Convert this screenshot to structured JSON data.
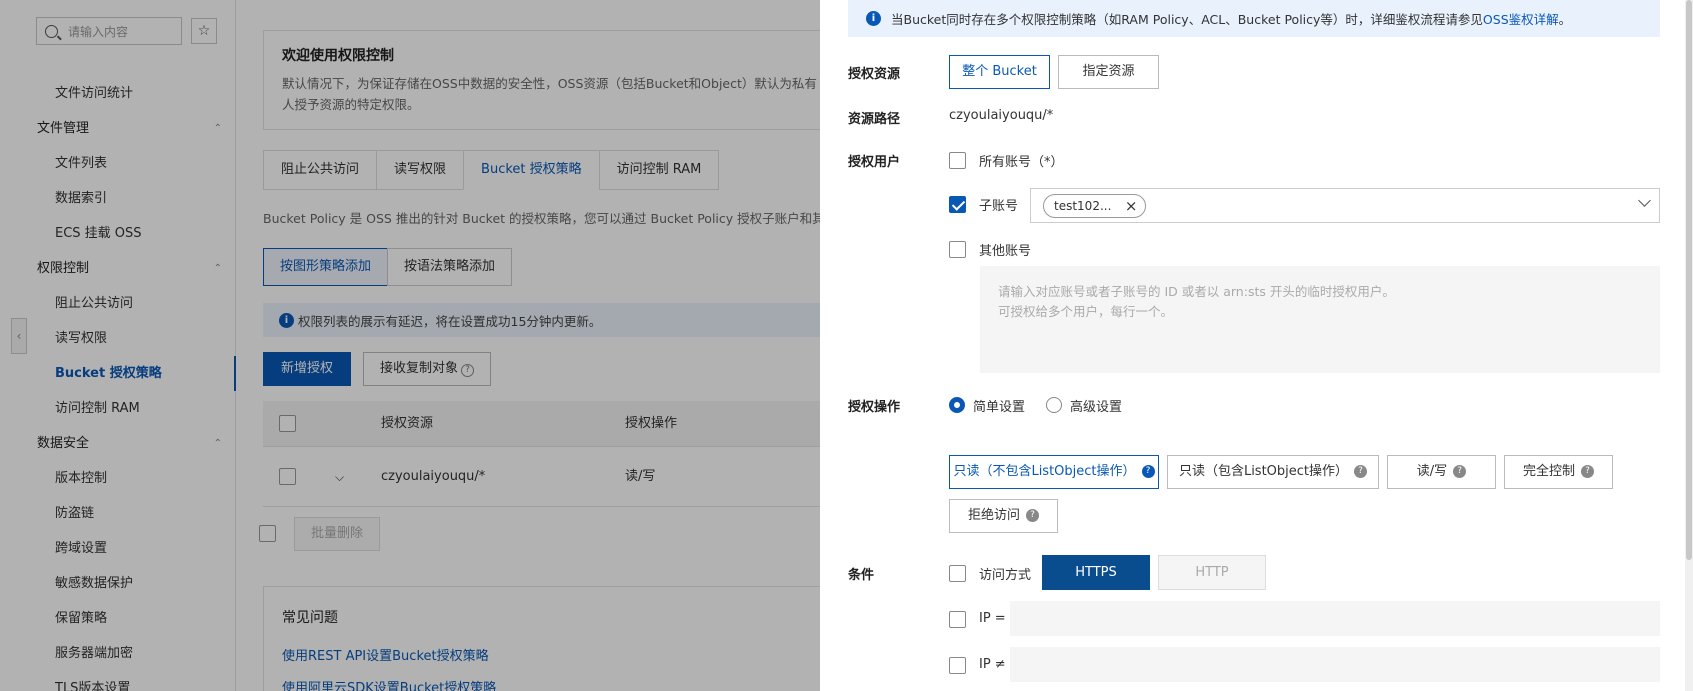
{
  "sidebar": {
    "search_placeholder": "请输入内容",
    "star": "☆",
    "items": [
      {
        "type": "item",
        "label": "文件访问统计"
      },
      {
        "type": "group",
        "label": "文件管理"
      },
      {
        "type": "item",
        "label": "文件列表"
      },
      {
        "type": "item",
        "label": "数据索引"
      },
      {
        "type": "item",
        "label": "ECS 挂载 OSS"
      },
      {
        "type": "group",
        "label": "权限控制"
      },
      {
        "type": "item",
        "label": "阻止公共访问"
      },
      {
        "type": "item",
        "label": "读写权限"
      },
      {
        "type": "item",
        "label": "Bucket 授权策略",
        "active": true
      },
      {
        "type": "item",
        "label": "访问控制 RAM"
      },
      {
        "type": "group",
        "label": "数据安全"
      },
      {
        "type": "item",
        "label": "版本控制"
      },
      {
        "type": "item",
        "label": "防盗链"
      },
      {
        "type": "item",
        "label": "跨域设置"
      },
      {
        "type": "item",
        "label": "敏感数据保护"
      },
      {
        "type": "item",
        "label": "保留策略"
      },
      {
        "type": "item",
        "label": "服务器端加密"
      },
      {
        "type": "item",
        "label": "TLS版本设置"
      }
    ]
  },
  "main": {
    "welcome_title": "欢迎使用权限控制",
    "welcome_text": "默认情况下，为保证存储在OSS中数据的安全性，OSS资源（包括Bucket和Object）默认为私有",
    "welcome_text2": "人授予资源的特定权限。",
    "tabs": [
      "阻止公共访问",
      "读写权限",
      "Bucket 授权策略",
      "访问控制 RAM"
    ],
    "desc": "Bucket Policy 是 OSS 推出的针对 Bucket 的授权策略，您可以通过 Bucket Policy 授权子账户和其",
    "policy_buttons": [
      "按图形策略添加",
      "按语法策略添加"
    ],
    "notice": "权限列表的展示有延迟，将在设置成功15分钟内更新。",
    "add_button": "新增授权",
    "receive_button": "接收复制对象",
    "table_headers": [
      "授权资源",
      "授权操作"
    ],
    "row": {
      "resource": "czyoulaiyouqu/*",
      "action": "读/写"
    },
    "bulk_delete": "批量删除",
    "faq_title": "常见问题",
    "faq_links": [
      "使用REST API设置Bucket授权策略",
      "使用阿里云SDK设置Bucket授权策略"
    ]
  },
  "drawer": {
    "alert_text": "当Bucket同时存在多个权限控制策略（如RAM Policy、ACL、Bucket Policy等）时，详细鉴权流程请参见",
    "alert_link": "OSS鉴权详解",
    "alert_end": "。",
    "resource_label": "授权资源",
    "resource_options": [
      "整个 Bucket",
      "指定资源"
    ],
    "path_label": "资源路径",
    "path_value": "czyoulaiyouqu/*",
    "user_label": "授权用户",
    "all_accounts": "所有账号（*）",
    "sub_account": "子账号",
    "sub_tag": "test102...",
    "other_accounts": "其他账号",
    "textarea_line1": "请输入对应账号或者子账号的 ID 或者以 arn:sts 开头的临时授权用户。",
    "textarea_line2": "可授权给多个用户，每行一个。",
    "action_label": "授权操作",
    "simple": "简单设置",
    "advanced": "高级设置",
    "actions": [
      "只读（不包含ListObject操作）",
      "只读（包含ListObject操作）",
      "读/写",
      "完全控制",
      "拒绝访问"
    ],
    "cond_label": "条件",
    "access_method": "访问方式",
    "https": "HTTPS",
    "http": "HTTP",
    "ip_eq": "IP =",
    "ip_neq": "IP ≠"
  },
  "colors": {
    "accent": "#0a58b5"
  }
}
